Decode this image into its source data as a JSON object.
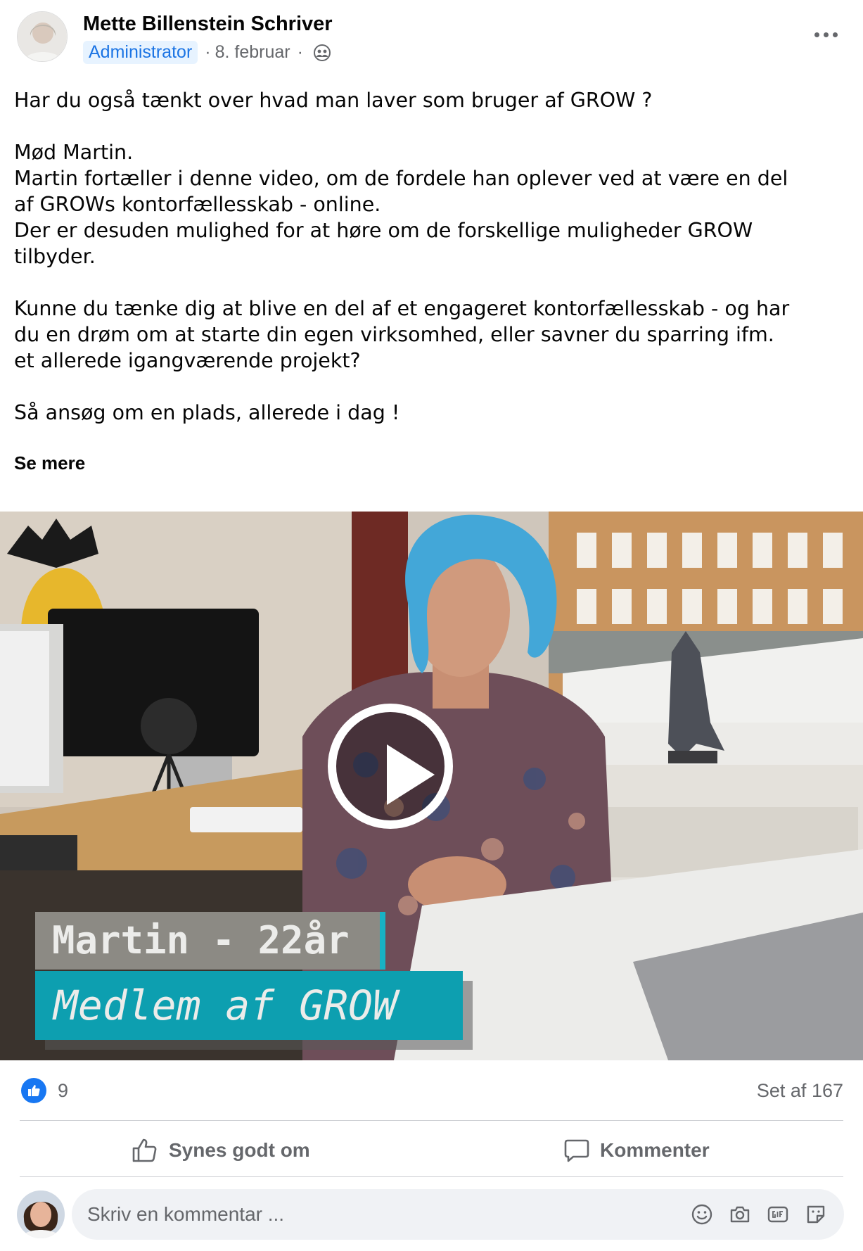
{
  "post": {
    "author": "Mette Billenstein Schriver",
    "role": "Administrator",
    "date": "8. februar",
    "separator": "·",
    "text_lines": [
      "Har du også tænkt over hvad man laver som bruger af GROW ?",
      "",
      "Mød Martin.",
      "Martin fortæller i denne video, om de fordele han oplever ved at være en del",
      "af GROWs kontorfællesskab - online.",
      "Der er desuden mulighed for at høre om de forskellige muligheder GROW",
      "tilbyder.",
      "",
      "Kunne du tænke dig at blive en del af et engageret kontorfællesskab - og har",
      "du en drøm om at starte din egen virksomhed, eller savner du sparring ifm.",
      "et allerede igangværende projekt?",
      "",
      "Så ansøg om en plads, allerede i dag !"
    ],
    "see_more": "Se mere"
  },
  "video": {
    "caption_name": "Martin - 22år",
    "caption_role": "Medlem af GROW"
  },
  "stats": {
    "likes": "9",
    "views": "Set af 167"
  },
  "actions": {
    "like_label": "Synes godt om",
    "comment_label": "Kommenter"
  },
  "comment": {
    "placeholder": "Skriv en kommentar ..."
  },
  "colors": {
    "accent": "#1877f2",
    "caption_teal": "#0d9fb0",
    "secondary_text": "#65676b"
  }
}
